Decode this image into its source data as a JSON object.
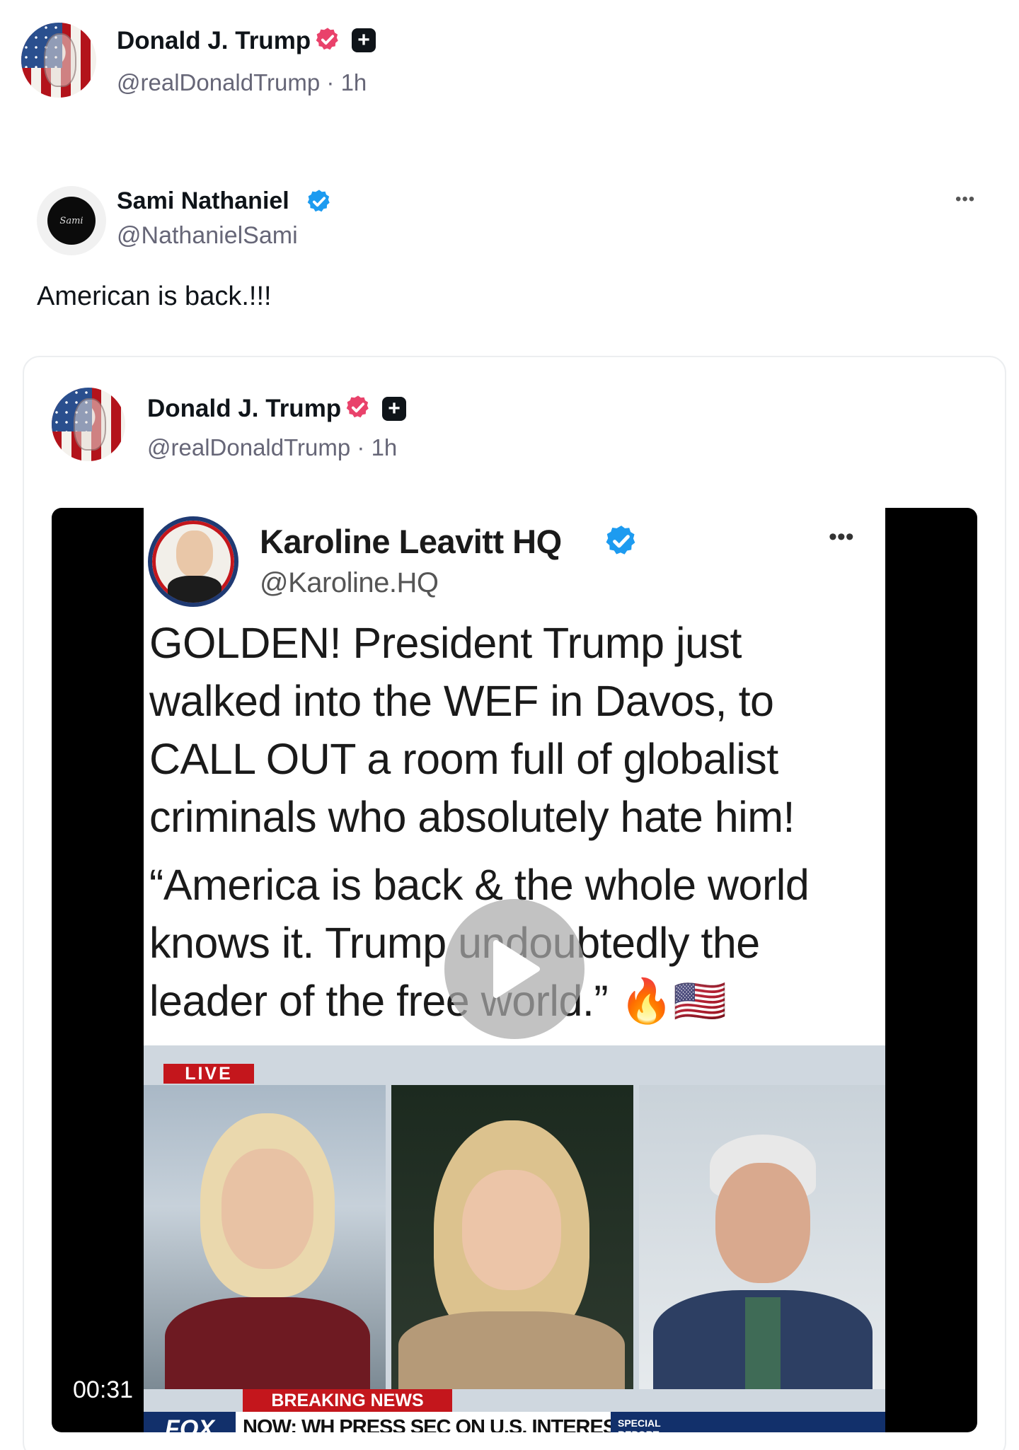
{
  "post": {
    "author": {
      "name": "Donald J. Trump",
      "handle": "@realDonaldTrump",
      "time": "1h"
    }
  },
  "reply": {
    "author": {
      "name": "Sami Nathaniel",
      "handle": "@NathanielSami",
      "avatar_text": "Sami"
    },
    "text": "American is back.!!!",
    "more_label": "•••"
  },
  "quoted": {
    "author": {
      "name": "Donald J. Trump",
      "handle": "@realDonaldTrump",
      "time": "1h"
    }
  },
  "video": {
    "duration": "00:31",
    "embedded_post": {
      "name": "Karoline Leavitt HQ",
      "handle": "@Karoline.HQ",
      "more_label": "•••",
      "lines": [
        "GOLDEN! President Trump just",
        "walked into the WEF in Davos, to",
        "CALL OUT a room full of globalist",
        "criminals who absolutely hate him!"
      ],
      "quote_lines": [
        "“America is back & the whole world",
        "knows it. Trump undoubtedly the",
        "leader of the free world.” 🔥🇺🇸"
      ]
    },
    "broadcast": {
      "live_label": "LIVE",
      "breaking_label": "BREAKING NEWS",
      "network": "FOX",
      "ticker": "NOW: WH PRESS SEC ON U.S. INTERESTS IN GREENLAND",
      "special_label": "SPECIAL REPORT"
    }
  },
  "colors": {
    "verified_pink": "#e9426b",
    "verified_blue": "#1d9bf0",
    "ticker_navy": "#12306b",
    "breaking_red": "#c4161c"
  },
  "icons": {
    "verified": "verified-badge-icon",
    "plus": "plus-box-icon",
    "more": "more-dots-icon",
    "play": "play-icon"
  }
}
